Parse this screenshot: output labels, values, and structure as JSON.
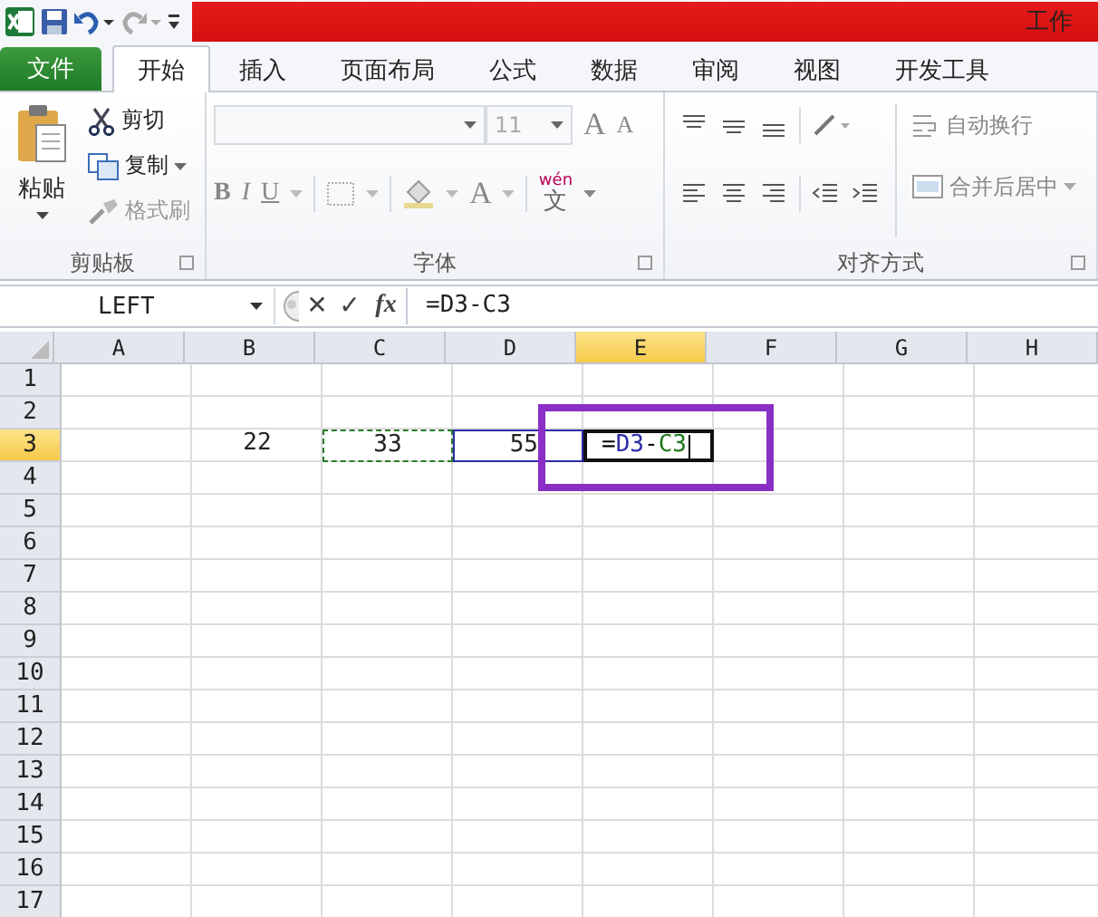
{
  "title_bar": {
    "title": "工作"
  },
  "tabs": [
    {
      "label": "文件",
      "kind": "file",
      "selected": false
    },
    {
      "label": "开始",
      "kind": "tab",
      "selected": true
    },
    {
      "label": "插入",
      "kind": "tab",
      "selected": false
    },
    {
      "label": "页面布局",
      "kind": "tab",
      "selected": false
    },
    {
      "label": "公式",
      "kind": "tab",
      "selected": false
    },
    {
      "label": "数据",
      "kind": "tab",
      "selected": false
    },
    {
      "label": "审阅",
      "kind": "tab",
      "selected": false
    },
    {
      "label": "视图",
      "kind": "tab",
      "selected": false
    },
    {
      "label": "开发工具",
      "kind": "tab",
      "selected": false
    }
  ],
  "ribbon": {
    "clipboard": {
      "label": "剪贴板",
      "paste": "粘贴",
      "commands": [
        {
          "label": "剪切",
          "kind": "scissors",
          "disabled": false,
          "dropdown": false
        },
        {
          "label": "复制",
          "kind": "copy",
          "disabled": false,
          "dropdown": true
        },
        {
          "label": "格式刷",
          "kind": "brush",
          "disabled": true,
          "dropdown": false
        }
      ]
    },
    "font": {
      "label": "字体",
      "font_size": "11",
      "grow": "A",
      "shrink": "A",
      "bold": "B",
      "italic": "I",
      "underline": "U",
      "font_color": "A",
      "phonetic_top": "wén",
      "phonetic_bottom": "文"
    },
    "alignment": {
      "label": "对齐方式",
      "wrap_text": "自动换行",
      "merge_center": "合并后居中"
    }
  },
  "formula_bar": {
    "name_box": "LEFT",
    "cancel": "✕",
    "enter": "✓",
    "fx": "fx",
    "formula": "=D3-C3"
  },
  "sheet": {
    "columns": [
      {
        "label": "A",
        "selected": false
      },
      {
        "label": "B",
        "selected": false
      },
      {
        "label": "C",
        "selected": false
      },
      {
        "label": "D",
        "selected": false
      },
      {
        "label": "E",
        "selected": true
      },
      {
        "label": "F",
        "selected": false
      },
      {
        "label": "G",
        "selected": false
      },
      {
        "label": "H",
        "selected": false
      }
    ],
    "rows": [
      {
        "label": "1",
        "selected": false
      },
      {
        "label": "2",
        "selected": false
      },
      {
        "label": "3",
        "selected": true,
        "cells": [
          {
            "kind": "empty"
          },
          {
            "kind": "number",
            "value": "22"
          },
          {
            "kind": "copy_source",
            "value": "33"
          },
          {
            "kind": "reference",
            "value": "55"
          },
          {
            "kind": "editing",
            "formula_parts": [
              {
                "text": "=",
                "color": "#000000"
              },
              {
                "text": "D3",
                "color": "#2c2ca8"
              },
              {
                "text": "-",
                "color": "#000000"
              },
              {
                "text": "C3",
                "color": "#1e7a1e"
              }
            ]
          },
          {
            "kind": "empty"
          },
          {
            "kind": "empty"
          },
          {
            "kind": "empty"
          }
        ]
      },
      {
        "label": "4",
        "selected": false
      },
      {
        "label": "5",
        "selected": false
      },
      {
        "label": "6",
        "selected": false
      },
      {
        "label": "7",
        "selected": false
      },
      {
        "label": "8",
        "selected": false
      },
      {
        "label": "9",
        "selected": false
      },
      {
        "label": "10",
        "selected": false
      },
      {
        "label": "11",
        "selected": false
      },
      {
        "label": "12",
        "selected": false
      },
      {
        "label": "13",
        "selected": false
      },
      {
        "label": "14",
        "selected": false
      },
      {
        "label": "15",
        "selected": false
      },
      {
        "label": "16",
        "selected": false
      },
      {
        "label": "17",
        "selected": false
      }
    ]
  }
}
